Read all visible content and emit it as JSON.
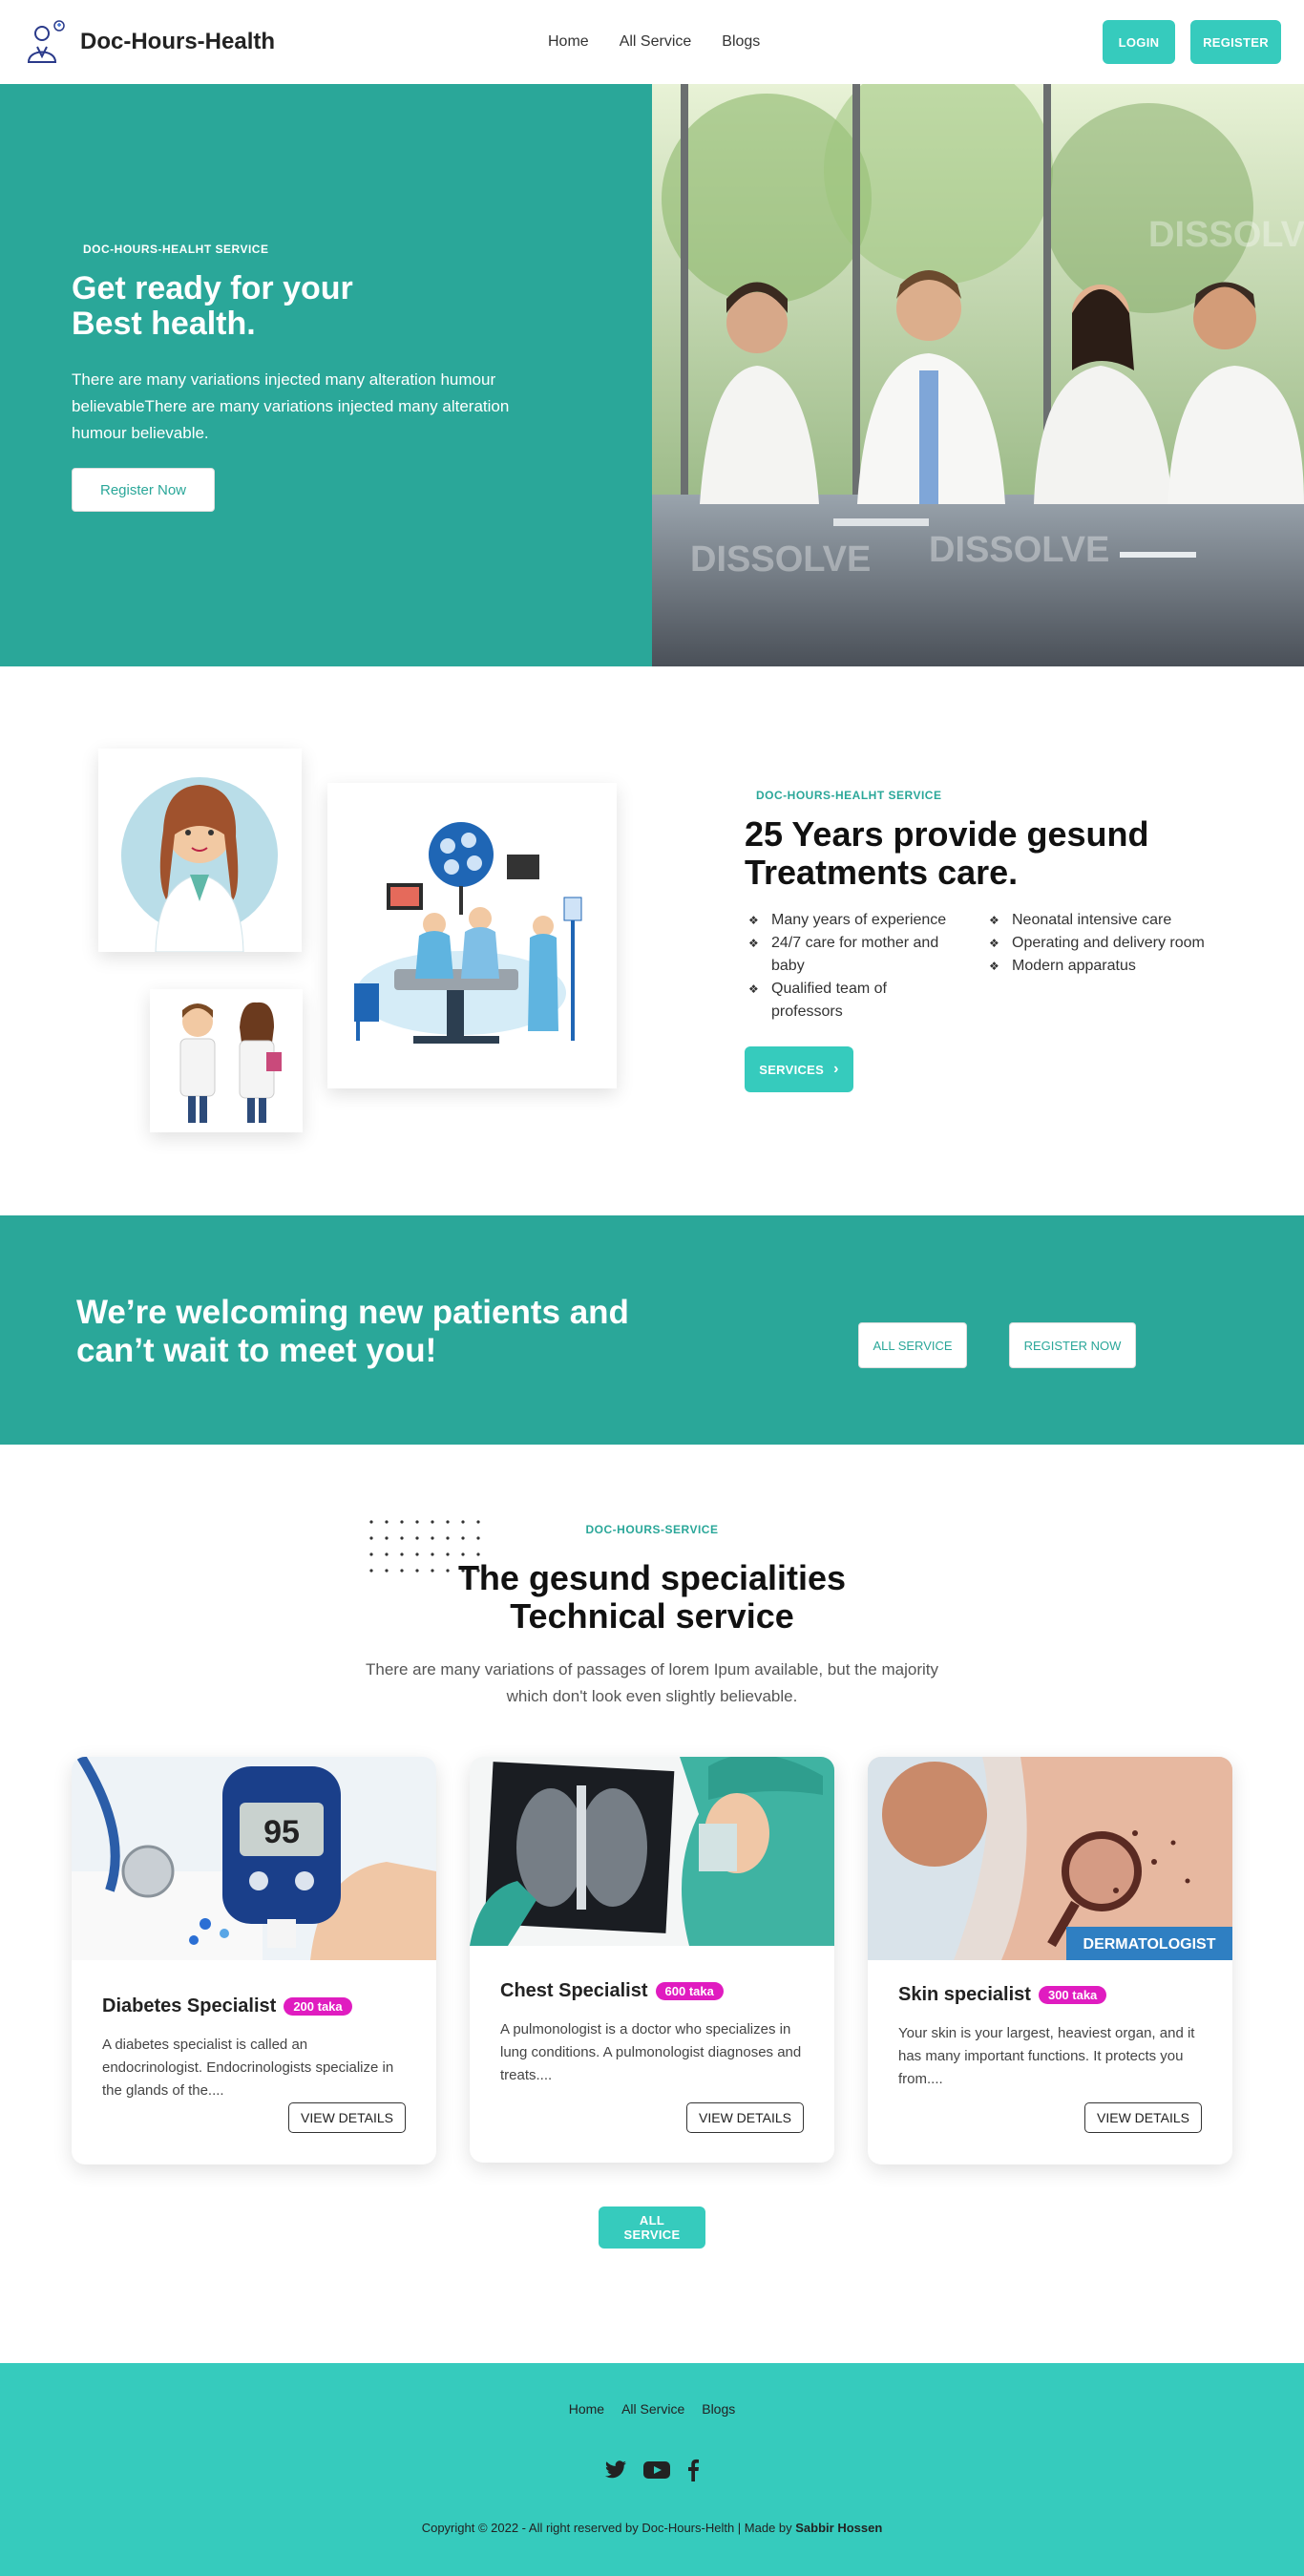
{
  "nav": {
    "brand": "Doc-Hours-Health",
    "menu": [
      "Home",
      "All Service",
      "Blogs"
    ],
    "login": "LOGIN",
    "register": "REGISTER"
  },
  "hero": {
    "eyebrow": "DOC-HOURS-HEALHT SERVICE",
    "title_line1": "Get ready for your",
    "title_line2": "Best health.",
    "text": "There are many variations injected many alteration humour believableThere are many variations injected many alteration humour believable.",
    "cta": "Register Now",
    "image_watermark": "DISSOLVE"
  },
  "about": {
    "eyebrow": "DOC-HOURS-HEALHT SERVICE",
    "title_line1": "25 Years provide gesund",
    "title_line2": "Treatments care.",
    "features_left": [
      "Many years of experience",
      "24/7 care for mother and baby",
      "Qualified team of professors"
    ],
    "features_right": [
      "Neonatal intensive care",
      "Operating and delivery room",
      "Modern apparatus"
    ],
    "cta": "SERVICES"
  },
  "cta": {
    "title": "We’re welcoming new patients and can’t wait to meet you!",
    "btn1": "ALL SERVICE",
    "btn2": "REGISTER NOW"
  },
  "services": {
    "eyebrow": "DOC-HOURS-SERVICE",
    "title_line1": "The gesund specialities",
    "title_line2": "Technical service",
    "lead_line1": "There are many variations of passages of lorem Ipum available, but the majority",
    "lead_line2": "which don't look even slightly believable.",
    "items": [
      {
        "title": "Diabetes Specialist",
        "price": "200 taka",
        "text": "A diabetes specialist is called an endocrinologist. Endocrinologists specialize in the glands of the....",
        "btn": "VIEW DETAILS",
        "display": "95"
      },
      {
        "title": "Chest Specialist",
        "price": "600 taka",
        "text": "A pulmonologist is a doctor who specializes in lung conditions. A pulmonologist diagnoses and treats....",
        "btn": "VIEW DETAILS"
      },
      {
        "title": "Skin specialist",
        "price": "300 taka",
        "text": "Your skin is your largest, heaviest organ, and it has many important functions. It protects you from....",
        "btn": "VIEW DETAILS",
        "tag": "DERMATOLOGIST"
      }
    ],
    "all": "ALL SERVICE"
  },
  "footer": {
    "menu": [
      "Home",
      "All Service",
      "Blogs"
    ],
    "copy_prefix": "Copyright © 2022 - All right reserved by Doc-Hours-Helth | Made by ",
    "author": "Sabbir Hossen"
  },
  "colors": {
    "teal_dark": "#2aa799",
    "teal_light": "#36cbbd",
    "price_badge": "#e01cc0"
  }
}
